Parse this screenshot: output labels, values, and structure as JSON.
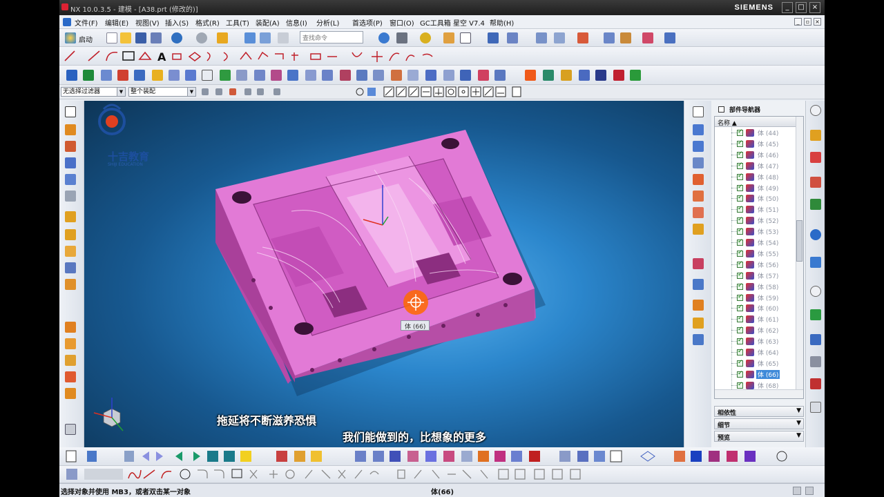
{
  "window": {
    "title": "NX 10.0.3.5 - 建模 - [A38.prt (修改的)]",
    "brand": "SIEMENS",
    "controls": [
      "_",
      "□",
      "×"
    ]
  },
  "menu": {
    "items": [
      "文件(F)",
      "编辑(E)",
      "视图(V)",
      "插入(S)",
      "格式(R)",
      "工具(T)",
      "装配(A)",
      "信息(I)",
      "分析(L)",
      "首选项(P)",
      "窗口(O)",
      "GC工具箱",
      "星空 V7.4",
      "帮助(H)"
    ]
  },
  "toolbar": {
    "start_label": "启动",
    "search_placeholder": "查找命令"
  },
  "selection_bar": {
    "filter_value": "无选择过滤器",
    "scope_value": "整个装配"
  },
  "viewport": {
    "logo_text": "十吉教育",
    "logo_sub": "SHIJI EDUCATION",
    "tooltip": "体 (66)",
    "subtitle_1": "拖延将不断滋养恐惧",
    "subtitle_2": "我们能做到的，比想象的更多",
    "background_color": "#1f6fb4",
    "part_color": "#e06ad0"
  },
  "navigator": {
    "title": "部件导航器",
    "column_header": "名称",
    "rows": [
      {
        "label": "体 (44)"
      },
      {
        "label": "体 (45)"
      },
      {
        "label": "体 (46)"
      },
      {
        "label": "体 (47)"
      },
      {
        "label": "体 (48)"
      },
      {
        "label": "体 (49)"
      },
      {
        "label": "体 (50)"
      },
      {
        "label": "体 (51)"
      },
      {
        "label": "体 (52)"
      },
      {
        "label": "体 (53)"
      },
      {
        "label": "体 (54)"
      },
      {
        "label": "体 (55)"
      },
      {
        "label": "体 (56)"
      },
      {
        "label": "体 (57)"
      },
      {
        "label": "体 (58)"
      },
      {
        "label": "体 (59)"
      },
      {
        "label": "体 (60)"
      },
      {
        "label": "体 (61)"
      },
      {
        "label": "体 (62)"
      },
      {
        "label": "体 (63)"
      },
      {
        "label": "体 (64)"
      },
      {
        "label": "体 (65)"
      },
      {
        "label": "体 (66)",
        "selected": true
      },
      {
        "label": "体 (68)"
      }
    ],
    "panels": [
      "相依性",
      "细节",
      "预览"
    ]
  },
  "status": {
    "prompt": "选择对象并使用 MB3，或者双击某一对象",
    "selection": "体(66)"
  }
}
